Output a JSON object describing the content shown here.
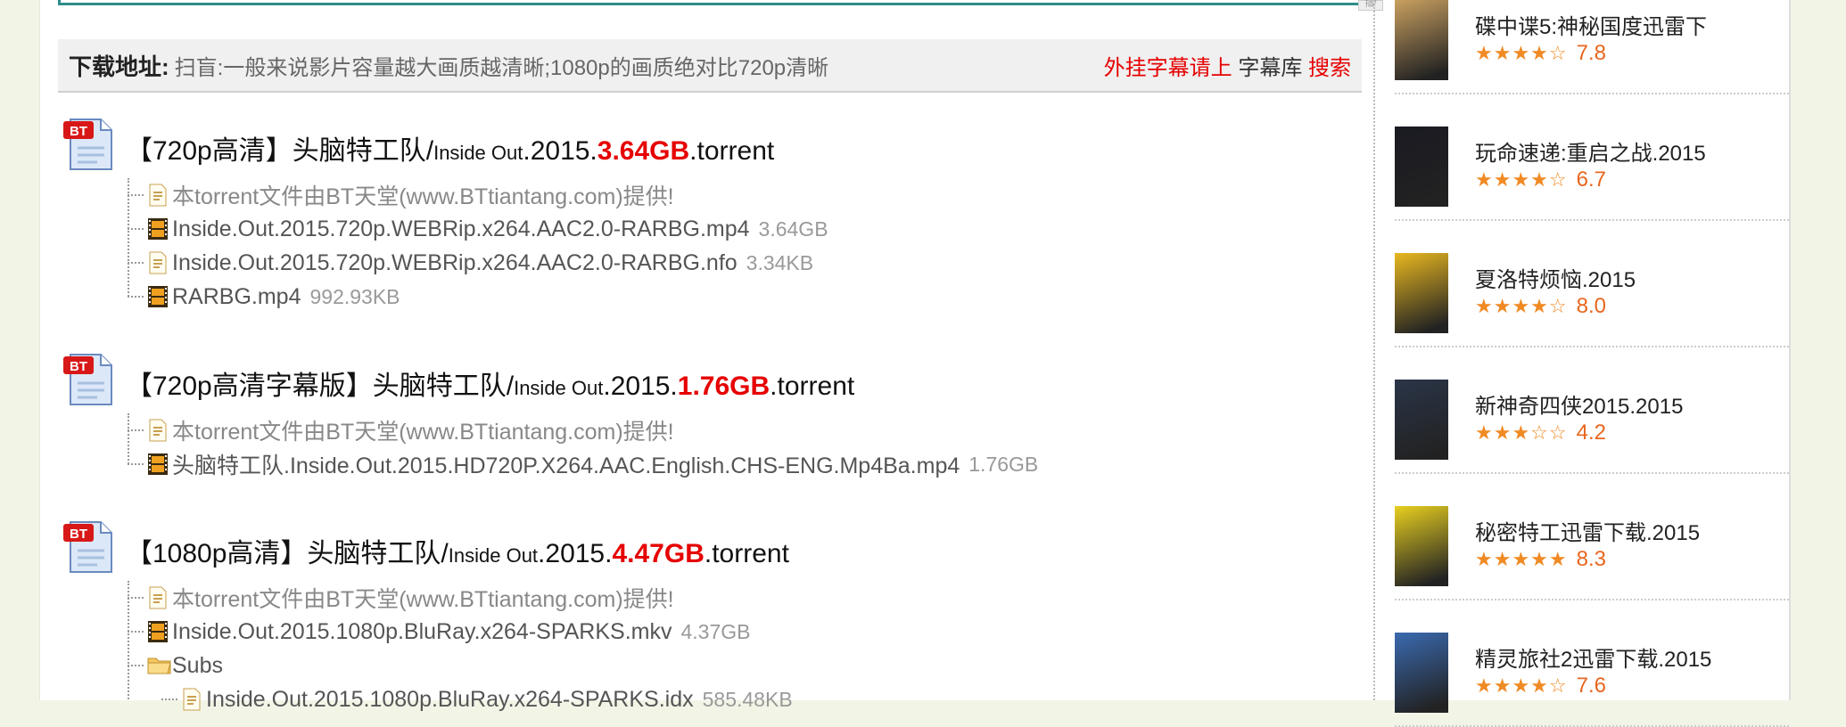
{
  "download": {
    "title": "下载地址:",
    "tip": "扫盲:一般来说影片容量越大画质越清晰;1080p的画质绝对比720p清晰",
    "right_red": "外挂字幕请上",
    "right_dark": "字幕库",
    "right_link": "搜索"
  },
  "torrents": [
    {
      "title_a": "【720p高清】头脑特工队/",
      "title_b": "Inside Out",
      "title_c": ".2015.",
      "size": "3.64GB",
      "title_d": ".torrent",
      "files": [
        {
          "icon": "text-file-icon",
          "name": "本torrent文件由BT天堂(www.BTtiantang.com)提供!",
          "size": ""
        },
        {
          "icon": "video-file-icon",
          "name": "Inside.Out.2015.720p.WEBRip.x264.AAC2.0-RARBG.mp4",
          "size": "3.64GB"
        },
        {
          "icon": "text-file-icon",
          "name": "Inside.Out.2015.720p.WEBRip.x264.AAC2.0-RARBG.nfo",
          "size": "3.34KB"
        },
        {
          "icon": "video-file-icon",
          "name": "RARBG.mp4",
          "size": "992.93KB"
        }
      ]
    },
    {
      "title_a": "【720p高清字幕版】头脑特工队/",
      "title_b": "Inside Out",
      "title_c": ".2015.",
      "size": "1.76GB",
      "title_d": ".torrent",
      "files": [
        {
          "icon": "text-file-icon",
          "name": "本torrent文件由BT天堂(www.BTtiantang.com)提供!",
          "size": ""
        },
        {
          "icon": "video-file-icon",
          "name": "头脑特工队.Inside.Out.2015.HD720P.X264.AAC.English.CHS-ENG.Mp4Ba.mp4",
          "size": "1.76GB"
        }
      ]
    },
    {
      "title_a": "【1080p高清】头脑特工队/",
      "title_b": "Inside Out",
      "title_c": ".2015.",
      "size": "4.47GB",
      "title_d": ".torrent",
      "files": [
        {
          "icon": "text-file-icon",
          "name": "本torrent文件由BT天堂(www.BTtiantang.com)提供!",
          "size": ""
        },
        {
          "icon": "video-file-icon",
          "name": "Inside.Out.2015.1080p.BluRay.x264-SPARKS.mkv",
          "size": "4.37GB"
        },
        {
          "icon": "folder-icon",
          "name": "Subs",
          "size": ""
        },
        {
          "icon": "text-file-icon",
          "name": "Inside.Out.2015.1080p.BluRay.x264-SPARKS.idx",
          "size": "585.48KB"
        }
      ]
    }
  ],
  "sidebar": [
    {
      "title": "碟中谍5:神秘国度迅雷下",
      "stars": "★★★★☆",
      "rating": "7.8",
      "rating_value": 7.8,
      "poster_color": "#c9a060"
    },
    {
      "title": "玩命速递:重启之战.2015",
      "stars": "★★★★☆",
      "rating": "6.7",
      "rating_value": 6.7,
      "poster_color": "#1a1a22"
    },
    {
      "title": "夏洛特烦恼.2015",
      "stars": "★★★★☆",
      "rating": "8.0",
      "rating_value": 8.0,
      "poster_color": "#e8b820"
    },
    {
      "title": "新神奇四侠2015.2015",
      "stars": "★★★☆☆",
      "rating": "4.2",
      "rating_value": 4.2,
      "poster_color": "#2a3548"
    },
    {
      "title": "秘密特工迅雷下载.2015",
      "stars": "★★★★★",
      "rating": "8.3",
      "rating_value": 8.3,
      "poster_color": "#e8d020"
    },
    {
      "title": "精灵旅社2迅雷下载.2015",
      "stars": "★★★★☆",
      "rating": "7.6",
      "rating_value": 7.6,
      "poster_color": "#3a6ab0"
    }
  ],
  "colors": {
    "accent_red": "#e60000",
    "star_orange": "#f08a24",
    "teal_border": "#2e8d8a"
  }
}
